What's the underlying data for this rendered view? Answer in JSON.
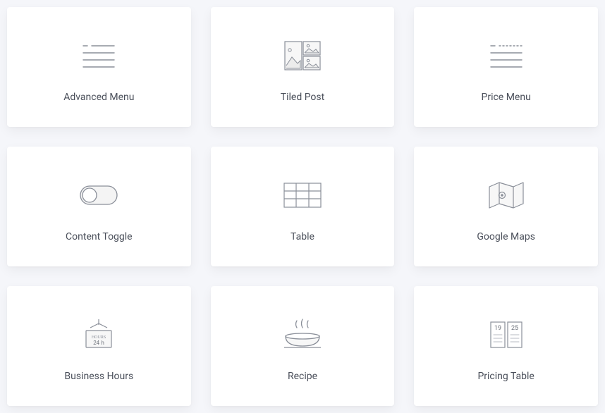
{
  "cards": [
    {
      "label": "Advanced Menu"
    },
    {
      "label": "Tiled Post"
    },
    {
      "label": "Price Menu"
    },
    {
      "label": "Content Toggle"
    },
    {
      "label": "Table"
    },
    {
      "label": "Google Maps"
    },
    {
      "label": "Business Hours"
    },
    {
      "label": "Recipe"
    },
    {
      "label": "Pricing Table"
    }
  ],
  "colors": {
    "iconStroke": "#8a8f99",
    "iconFill": "#f2f2f2"
  }
}
